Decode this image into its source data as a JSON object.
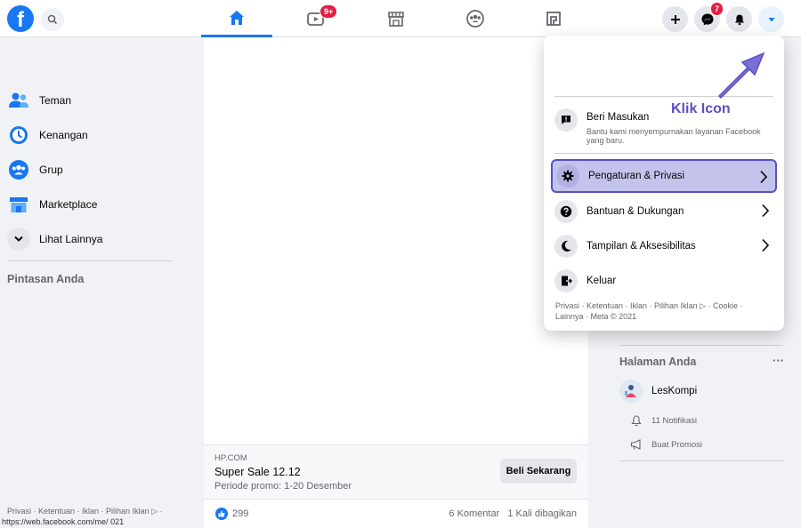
{
  "topbar": {
    "logo_letter": "f",
    "video_badge": "9+",
    "messenger_badge": "7"
  },
  "left_nav": {
    "items": [
      {
        "label": "Teman"
      },
      {
        "label": "Kenangan"
      },
      {
        "label": "Grup"
      },
      {
        "label": "Marketplace"
      },
      {
        "label": "Lihat Lainnya"
      }
    ],
    "shortcuts_title": "Pintasan Anda",
    "footer": "Privasi · Ketentuan · Iklan · Pilihan Iklan ▷ ·",
    "status_url": "https://web.facebook.com/me/",
    "status_url_tail": "021"
  },
  "feed": {
    "ad": {
      "domain": "HP.COM",
      "title": "Super Sale 12.12",
      "subtitle": "Periode promo: 1-20 Desember",
      "button": "Beli Sekarang"
    },
    "likes": "299",
    "comments": "6 Komentar",
    "shares": "1 Kali dibagikan"
  },
  "menu": {
    "feedback": {
      "title": "Beri Masukan",
      "subtitle": "Bantu kami menyempurnakan layanan Facebook yang baru."
    },
    "items": [
      {
        "label": "Pengaturan & Privasi"
      },
      {
        "label": "Bantuan & Dukungan"
      },
      {
        "label": "Tampilan & Aksesibilitas"
      },
      {
        "label": "Keluar"
      }
    ],
    "footer": "Privasi · Ketentuan · Iklan · Pilihan Iklan ▷ · Cookie · Lainnya · Meta © 2021"
  },
  "annotation": "Klik Icon",
  "right_col": {
    "pages_title": "Halaman Anda",
    "more": "···",
    "page_name": "LesKompi",
    "notifications": "11 Notifikasi",
    "promo": "Buat Promosi"
  },
  "colors": {
    "brand": "#1877f2",
    "badge": "#e41e3f",
    "highlight": "#c4c3ec",
    "annotation": "#5b50c3"
  },
  "icons": [
    "facebook-logo",
    "search-icon",
    "home-icon",
    "video-icon",
    "marketplace-icon",
    "groups-icon",
    "gaming-icon",
    "plus-icon",
    "messenger-icon",
    "bell-icon",
    "caret-down-icon",
    "friends-icon",
    "memories-icon",
    "group-icon",
    "store-icon",
    "chevron-down-icon",
    "feedback-icon",
    "gear-icon",
    "help-icon",
    "moon-icon",
    "logout-icon",
    "chevron-right-icon",
    "like-icon",
    "bell-outline-icon",
    "megaphone-icon"
  ]
}
